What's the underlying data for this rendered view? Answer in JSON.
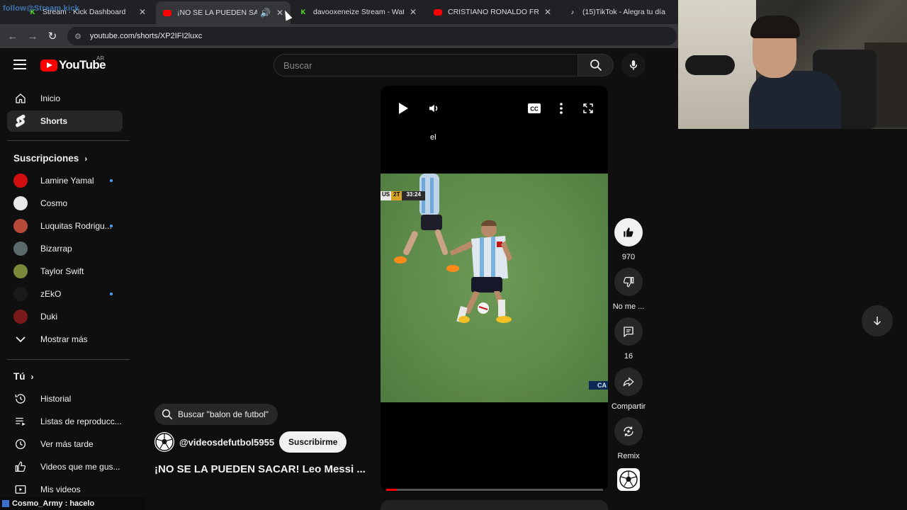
{
  "browser": {
    "overlay_text": "follow@Stream.kick",
    "tabs": [
      {
        "title": "Stream · Kick Dashboard",
        "icon": "kick-icon"
      },
      {
        "title": "¡NO SE LA PUEDEN SACAR!",
        "icon": "youtube-icon",
        "active": true
      },
      {
        "title": "davooxeneize Stream - Watch Live",
        "icon": "kick-icon"
      },
      {
        "title": "CRISTIANO RONALDO FREEKICK",
        "icon": "youtube-icon"
      },
      {
        "title": "(15)TikTok - Alegra tu día",
        "icon": "tiktok-icon"
      }
    ],
    "url": "youtube.com/shorts/XP2IFI2luxc"
  },
  "header": {
    "logo_text": "YouTube",
    "country_code": "AR",
    "search_placeholder": "Buscar"
  },
  "sidebar": {
    "nav": [
      {
        "label": "Inicio",
        "icon": "home-icon"
      },
      {
        "label": "Shorts",
        "icon": "shorts-icon",
        "active": true
      }
    ],
    "subscriptions_title": "Suscripciones",
    "subscriptions": [
      {
        "label": "Lamine Yamal",
        "color": "#d10f0f",
        "new": true
      },
      {
        "label": "Cosmo",
        "color": "#e8e8e8",
        "new": false
      },
      {
        "label": "Luquitas Rodrigu...",
        "color": "#b84a3a",
        "new": true
      },
      {
        "label": "Bizarrap",
        "color": "#5a6a6a",
        "new": false
      },
      {
        "label": "Taylor Swift",
        "color": "#7a8a3a",
        "new": false
      },
      {
        "label": "zEkO",
        "color": "#1a1a1a",
        "new": true
      },
      {
        "label": "Duki",
        "color": "#7a1a1a",
        "new": false
      }
    ],
    "show_more": "Mostrar más",
    "you_title": "Tú",
    "you_items": [
      {
        "label": "Historial",
        "icon": "history-icon"
      },
      {
        "label": "Listas de reproducc...",
        "icon": "playlist-icon"
      },
      {
        "label": "Ver más tarde",
        "icon": "watch-later-icon"
      },
      {
        "label": "Videos que me gus...",
        "icon": "like-icon"
      },
      {
        "label": "Mis videos",
        "icon": "my-videos-icon"
      }
    ]
  },
  "player": {
    "caption": "el",
    "score_team": "US",
    "score_period": "2T",
    "score_time": "33:24",
    "field_tag": "CA",
    "progress": 0.05
  },
  "actions": {
    "likes": "970",
    "dislike_label": "No me ...",
    "comments": "16",
    "share_label": "Compartir",
    "remix_label": "Remix"
  },
  "info": {
    "search_chip": "Buscar \"balon de futbol\"",
    "channel": "@videosdefutbol5955",
    "subscribe": "Suscribirme",
    "title": "¡NO SE LA PUEDEN SACAR! Leo Messi ..."
  },
  "chat": {
    "user": "Cosmo_Army",
    "message": "hacelo"
  }
}
